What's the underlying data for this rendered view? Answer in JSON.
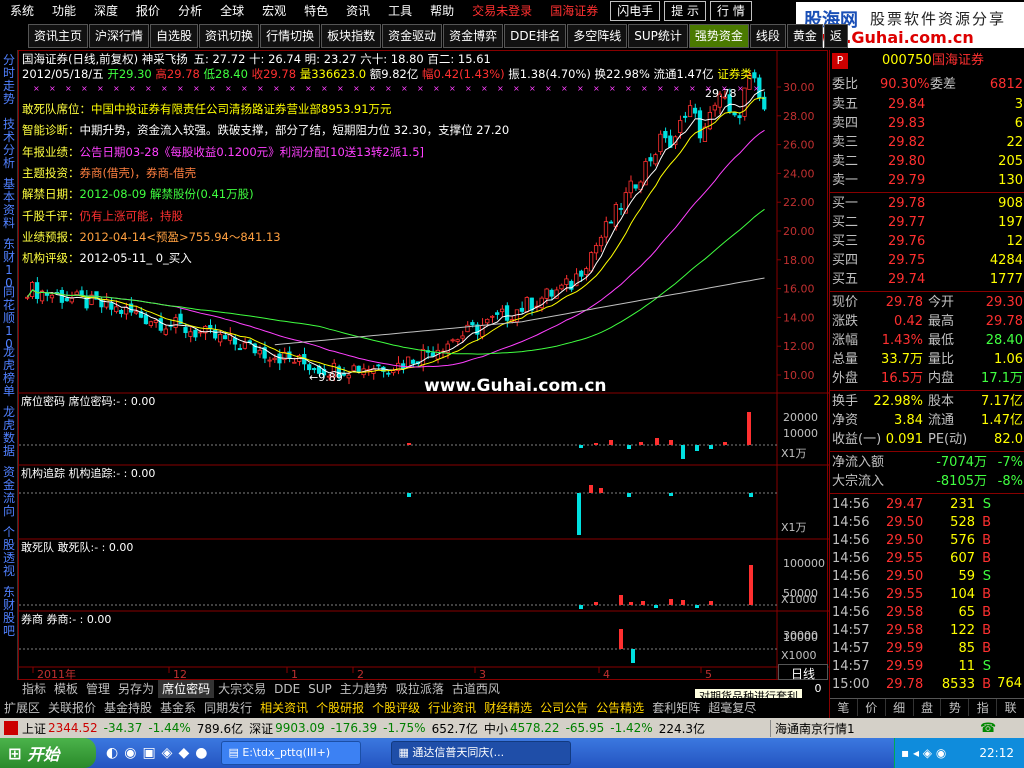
{
  "menu": {
    "items": [
      "系统",
      "功能",
      "深度",
      "报价",
      "分析",
      "全球",
      "宏观",
      "特色",
      "资讯",
      "工具",
      "帮助"
    ],
    "trade": "交易未登录",
    "broker": "国海证券",
    "boxes": [
      "闪电手",
      "提 示",
      "行 情"
    ]
  },
  "logo": {
    "name": "股海网",
    "slogan": "股票软件资源分享",
    "url": "www.Guhai.com.cn"
  },
  "toolbar": [
    "资讯主页",
    "沪深行情",
    "自选股",
    "资讯切换",
    "行情切换",
    "板块指数",
    "资金驱动",
    "资金博弈",
    "DDE排名",
    "多空阵线",
    "SUP统计",
    "强势资金",
    "线段",
    "黄金",
    "返"
  ],
  "toolbar_active": "强势资金",
  "left_tabs": [
    "分时走势",
    "技术分析",
    "基本资料",
    "东财10",
    "同花顺10",
    "龙虎榜单",
    "龙虎数据",
    "资金流向",
    "个股透视",
    "东财股吧"
  ],
  "chart_header": {
    "line1_title": "国海证券(日线,前复权) 神采飞扬",
    "line1_vals": "五: 27.72  十: 26.74  明: 23.27  六十: 18.80  百二: 15.61",
    "line2_date": "2012/05/18/五",
    "line2_open": "开29.30",
    "line2_high": "高29.78",
    "line2_low": "低28.40",
    "line2_close": "收29.78",
    "line2_vol": "量336623.0",
    "line2_amt": "额9.82亿",
    "line2_chg": "幅0.42(1.43%)",
    "line2_rest": "振1.38(4.70%) 换22.98% 流通1.47亿",
    "line2_tag": "证券类"
  },
  "info_lines": [
    {
      "label": "敢死队席位：",
      "text": "中国中投证券有限责任公司清扬路证券营业部8953.91万元",
      "color": "#ffff00"
    },
    {
      "label": "智能诊断：",
      "text": "中期升势，资金流入较强。跌破支撑，部分了结，短期阻力位 32.30，支撑位 27.20",
      "color": "#ffffff"
    },
    {
      "label": "年报业绩：",
      "text": "公告日期03-28《每股收益0.1200元》利润分配[10送13转2派1.5]",
      "color": "#ff40ff"
    },
    {
      "label": "主题投资：",
      "text": "券商(借壳)，券商-借壳",
      "color": "#ff8040"
    },
    {
      "label": "解禁日期：",
      "text": "2012-08-09 解禁股份(0.41万股)",
      "color": "#40ff40"
    },
    {
      "label": "千股千评：",
      "text": "仍有上涨可能，持股",
      "color": "#ff3030"
    },
    {
      "label": "业绩预报：",
      "text": "2012-04-14<预盈>755.94～841.13",
      "color": "#ffa040"
    },
    {
      "label": "机构评级：",
      "text": "2012-05-11_ 0_买入",
      "color": "#ffffff"
    }
  ],
  "price_axis": [
    "30.00",
    "28.00",
    "26.00",
    "24.00",
    "22.00",
    "20.00",
    "18.00",
    "16.00",
    "14.00",
    "12.00",
    "10.00"
  ],
  "price_max_label": "29.78",
  "price_min_label": "9.89",
  "watermark": "www.Guhai.com.cn",
  "panels": [
    {
      "title": "席位密码 席位密码:-",
      "val": ": 0.00",
      "axis_top": "20000",
      "axis_mid": "10000",
      "unit": "X1万"
    },
    {
      "title": "机构追踪 机构追踪:-",
      "val": ": 0.00",
      "unit": "X1万"
    },
    {
      "title": "敢死队 敢死队:-",
      "val": ": 0.00",
      "axis_top": "100000",
      "axis_mid": "50000",
      "unit": "X1000"
    },
    {
      "title": "券商 券商:-",
      "val": ": 0.00",
      "axis_top": "30000",
      "axis_mid": "10000",
      "unit": "X1000"
    }
  ],
  "time_axis": [
    "2011年",
    "12",
    "1",
    "2",
    "3",
    "4",
    "5"
  ],
  "period": "日线",
  "period_num": "0",
  "bottom_tabs": [
    "指标",
    "模板",
    "管理",
    "另存为",
    "席位密码",
    "大宗交易",
    "DDE",
    "SUP",
    "主力趋势",
    "吸拉派落",
    "古道西风"
  ],
  "bottom_tab_active": "席位密码",
  "tooltip": "对期货品种进行套利",
  "link_bar": [
    "扩展区",
    "关联报价",
    "基金持股",
    "基金系",
    "同期发行",
    "相关资讯",
    "个股研报",
    "个股评级",
    "行业资讯",
    "财经精选",
    "公司公告",
    "公告精选",
    "套利矩阵",
    "超毫复尽"
  ],
  "link_bar_gold": [
    "相关资讯",
    "个股研报",
    "个股评级",
    "行业资讯",
    "财经精选",
    "公司公告",
    "公告精选"
  ],
  "quote": {
    "code": "000750",
    "name": "国海证券",
    "p_badge": "P",
    "weibi_label": "委比",
    "weibi": "90.30%",
    "weicha_label": "委差",
    "weicha": "6812",
    "sell": [
      {
        "label": "卖五",
        "price": "29.84",
        "vol": "3"
      },
      {
        "label": "卖四",
        "price": "29.83",
        "vol": "6"
      },
      {
        "label": "卖三",
        "price": "29.82",
        "vol": "22"
      },
      {
        "label": "卖二",
        "price": "29.80",
        "vol": "205"
      },
      {
        "label": "卖一",
        "price": "29.79",
        "vol": "130"
      }
    ],
    "buy": [
      {
        "label": "买一",
        "price": "29.78",
        "vol": "908"
      },
      {
        "label": "买二",
        "price": "29.77",
        "vol": "197"
      },
      {
        "label": "买三",
        "price": "29.76",
        "vol": "12"
      },
      {
        "label": "买四",
        "price": "29.75",
        "vol": "4284"
      },
      {
        "label": "买五",
        "price": "29.74",
        "vol": "1777"
      }
    ],
    "stats": [
      {
        "l1": "现价",
        "v1": "29.78",
        "c1": "#ff3030",
        "l2": "今开",
        "v2": "29.30",
        "c2": "#ff3030"
      },
      {
        "l1": "涨跌",
        "v1": "0.42",
        "c1": "#ff3030",
        "l2": "最高",
        "v2": "29.78",
        "c2": "#ff3030"
      },
      {
        "l1": "涨幅",
        "v1": "1.43%",
        "c1": "#ff3030",
        "l2": "最低",
        "v2": "28.40",
        "c2": "#40ff40"
      },
      {
        "l1": "总量",
        "v1": "33.7万",
        "c1": "#ffff00",
        "l2": "量比",
        "v2": "1.06",
        "c2": "#ffff00"
      },
      {
        "l1": "外盘",
        "v1": "16.5万",
        "c1": "#ff3030",
        "l2": "内盘",
        "v2": "17.1万",
        "c2": "#40ff40"
      }
    ],
    "stats2": [
      {
        "l1": "换手",
        "v1": "22.98%",
        "l2": "股本",
        "v2": "7.17亿"
      },
      {
        "l1": "净资",
        "v1": "3.84",
        "l2": "流通",
        "v2": "1.47亿"
      },
      {
        "l1": "收益(一)",
        "v1": "0.091",
        "l2": "PE(动)",
        "v2": "82.0"
      }
    ],
    "flow": [
      {
        "label": "净流入额",
        "val": "-7074万",
        "pct": "-7%"
      },
      {
        "label": "大宗流入",
        "val": "-8105万",
        "pct": "-8%"
      }
    ],
    "ticks": [
      {
        "t": "14:56",
        "p": "29.47",
        "v": "231",
        "d": "S"
      },
      {
        "t": "14:56",
        "p": "29.50",
        "v": "528",
        "d": "B"
      },
      {
        "t": "14:56",
        "p": "29.50",
        "v": "576",
        "d": "B"
      },
      {
        "t": "14:56",
        "p": "29.55",
        "v": "607",
        "d": "B"
      },
      {
        "t": "14:56",
        "p": "29.50",
        "v": "59",
        "d": "S"
      },
      {
        "t": "14:56",
        "p": "29.55",
        "v": "104",
        "d": "B"
      },
      {
        "t": "14:56",
        "p": "29.58",
        "v": "65",
        "d": "B"
      },
      {
        "t": "14:57",
        "p": "29.58",
        "v": "122",
        "d": "B"
      },
      {
        "t": "14:57",
        "p": "29.59",
        "v": "85",
        "d": "B"
      },
      {
        "t": "14:57",
        "p": "29.59",
        "v": "11",
        "d": "S"
      },
      {
        "t": "15:00",
        "p": "29.78",
        "v": "8533",
        "d": "B"
      }
    ],
    "tick_last_num": "764",
    "right_tabs": [
      "笔",
      "价",
      "细",
      "盘",
      "势",
      "指",
      "联"
    ]
  },
  "status": {
    "sh_label": "上证",
    "sh_val": "2344.52",
    "sh_chg": "-34.37",
    "sh_pct": "-1.44%",
    "sh_amt": "789.6亿",
    "sz_label": "深证",
    "sz_val": "9903.09",
    "sz_chg": "-176.39",
    "sz_pct": "-1.75%",
    "sz_amt": "652.7亿",
    "zx_label": "中小",
    "zx_val": "4578.22",
    "zx_chg": "-65.95",
    "zx_pct": "-1.42%",
    "zx_amt": "224.3亿",
    "site": "海通南京行情1"
  },
  "taskbar": {
    "start": "开始",
    "t1": "E:\\tdx_pttq(III+)",
    "t2": "通达信普天同庆(...",
    "clock": "22:12"
  },
  "colors": {
    "up": "#ff3030",
    "down": "#00e0e0",
    "ma5": "#ffffff",
    "ma10": "#ffff00",
    "ma20": "#ff40ff",
    "ma60": "#40ff40",
    "ma120": "#c0c0c0"
  }
}
